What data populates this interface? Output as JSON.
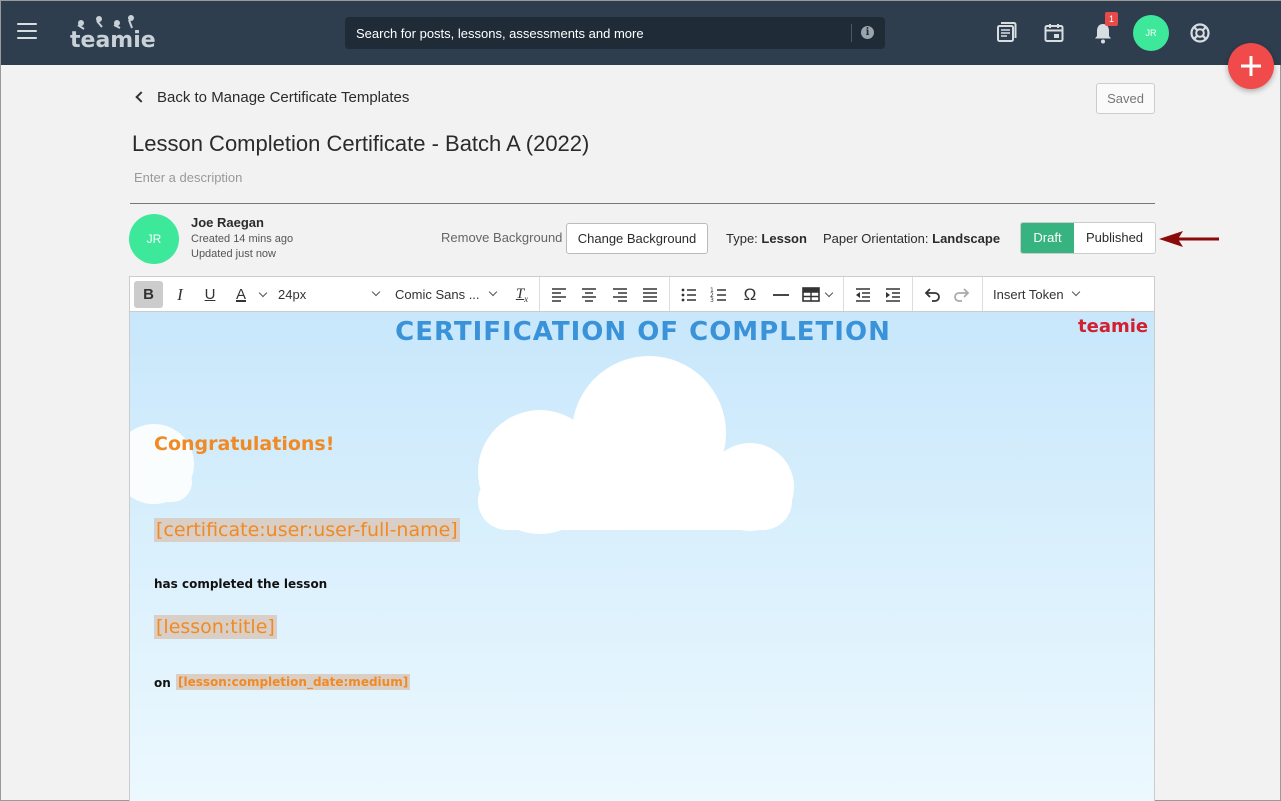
{
  "topbar": {
    "search_placeholder": "Search for posts, lessons, assessments and more",
    "notification_count": "1",
    "user_initials": "JR",
    "logo_text": "teamie"
  },
  "header": {
    "back_label": "Back to Manage Certificate Templates",
    "saved_label": "Saved",
    "title": "Lesson Completion Certificate - Batch A (2022)",
    "description_placeholder": "Enter a description"
  },
  "meta": {
    "author_initials": "JR",
    "author_name": "Joe Raegan",
    "created": "Created 14 mins ago",
    "updated": "Updated just now",
    "remove_background": "Remove Background",
    "change_background": "Change Background",
    "type_label": "Type:",
    "type_value": "Lesson",
    "orientation_label": "Paper Orientation:",
    "orientation_value": "Landscape",
    "status_options": [
      "Draft",
      "Published"
    ],
    "status_selected": "Draft"
  },
  "toolbar": {
    "font_size": "24px",
    "font_family": "Comic Sans ...",
    "insert_token": "Insert Token"
  },
  "certificate": {
    "title": "CERTIFICATION OF COMPLETION",
    "logo": "teamie",
    "congrats": "Congratulations!",
    "name_token": "[certificate:user:user-full-name]",
    "completed_text": "has completed the lesson",
    "lesson_token": "[lesson:title]",
    "on_text": "on",
    "date_token": "[lesson:completion_date:medium]"
  },
  "colors": {
    "topbar": "#2e3e4e",
    "accent_green": "#36b37e",
    "avatar": "#3ee89a",
    "fab": "#f14a4a",
    "cert_title": "#3a93d8",
    "token_text": "#f08a24",
    "arrow": "#8b0a0a"
  }
}
